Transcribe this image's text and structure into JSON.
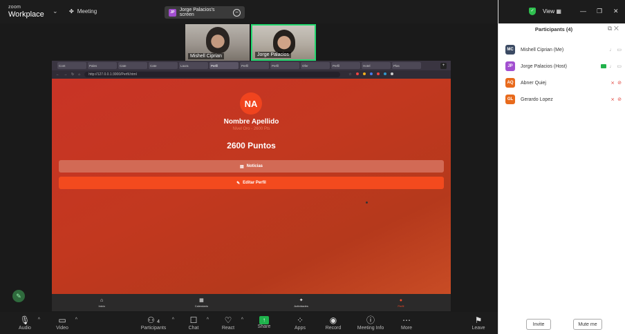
{
  "app": {
    "logo_top": "zoom",
    "logo_bottom": "Workplace",
    "meeting_label": "Meeting"
  },
  "share_banner": {
    "initials": "JP",
    "text": "Jorge Palacios's screen"
  },
  "thumbnails": [
    {
      "name": "Mishell Ciprian"
    },
    {
      "name": "Jorge Palacios"
    }
  ],
  "browser": {
    "url": "http://127.0.0.1:3000/Perfil.html",
    "tabs": [
      "Cont",
      "Pales",
      "Cate",
      "Cate",
      "Laura",
      "Perfil",
      "Perfil",
      "Perfil",
      "Ofer",
      "Perfil",
      "Hotel",
      "Plas"
    ]
  },
  "profile": {
    "initials": "NA",
    "name": "Nombre Apellido",
    "level": "Nivel Oro - 2600 Pts",
    "points": "2600 Puntos",
    "news_button": "Noticias",
    "edit_button": "Editar Perfil"
  },
  "bottom_nav": [
    {
      "label": "Inicio",
      "icon": "home-icon"
    },
    {
      "label": "Calendario",
      "icon": "calendar-icon"
    },
    {
      "label": "Actividades",
      "icon": "activities-icon"
    },
    {
      "label": "Perfil",
      "icon": "profile-icon"
    }
  ],
  "participants_panel": {
    "view_label": "View",
    "title": "Participants (4)",
    "participants": [
      {
        "initials": "MC",
        "name": "Mishell Ciprian (Me)",
        "color": "#3b4a63"
      },
      {
        "initials": "JP",
        "name": "Jorge Palacios (Host)",
        "color": "#a24fd0"
      },
      {
        "initials": "AQ",
        "name": "Abner Quiej",
        "color": "#e86a1c"
      },
      {
        "initials": "GL",
        "name": "Gerardo Lopez",
        "color": "#e86a1c"
      }
    ],
    "invite_label": "Invite",
    "mute_label": "Mute me"
  },
  "toolbar": {
    "audio": "Audio",
    "video": "Video",
    "participants": "Participants",
    "participants_count": "4",
    "chat": "Chat",
    "react": "React",
    "share": "Share",
    "apps": "Apps",
    "record": "Record",
    "meeting_info": "Meeting Info",
    "more": "More",
    "leave": "Leave"
  },
  "colors": {
    "accent_green": "#23d96f",
    "profile_accent": "#f34a1e",
    "leave_red": "#e84646"
  }
}
